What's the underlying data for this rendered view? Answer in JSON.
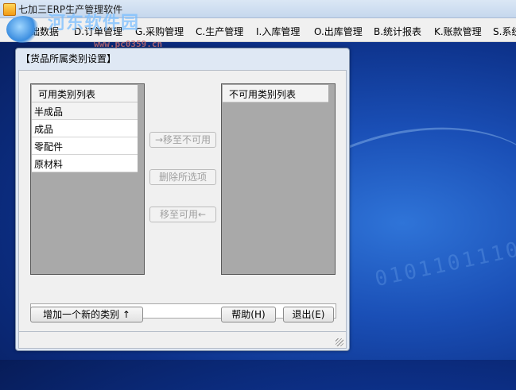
{
  "window": {
    "title": "七加三ERP生产管理软件"
  },
  "watermark": {
    "text": "河东软件园",
    "url": "www.pc0359.cn"
  },
  "menu": [
    "基础数据",
    "D.订单管理",
    "G.采购管理",
    "C.生产管理",
    "I.入库管理",
    "O.出库管理",
    "B.统计报表",
    "K.账款管理",
    "S.系统"
  ],
  "dialog": {
    "title": "【货品所属类别设置】",
    "available_list": {
      "header": "可用类别列表",
      "items": [
        "半成品",
        "成品",
        "零配件",
        "原材料"
      ]
    },
    "unavailable_list": {
      "header": "不可用类别列表",
      "items": []
    },
    "buttons": {
      "move_to_unavailable": "→移至不可用",
      "delete_selected": "删除所选项",
      "move_to_available": "移至可用←",
      "add_category": "增加一个新的类别 ↑",
      "help": "帮助(H)",
      "exit": "退出(E)"
    },
    "input": {
      "value": ""
    }
  },
  "desktop": {
    "decoration_text": "0101101110"
  }
}
